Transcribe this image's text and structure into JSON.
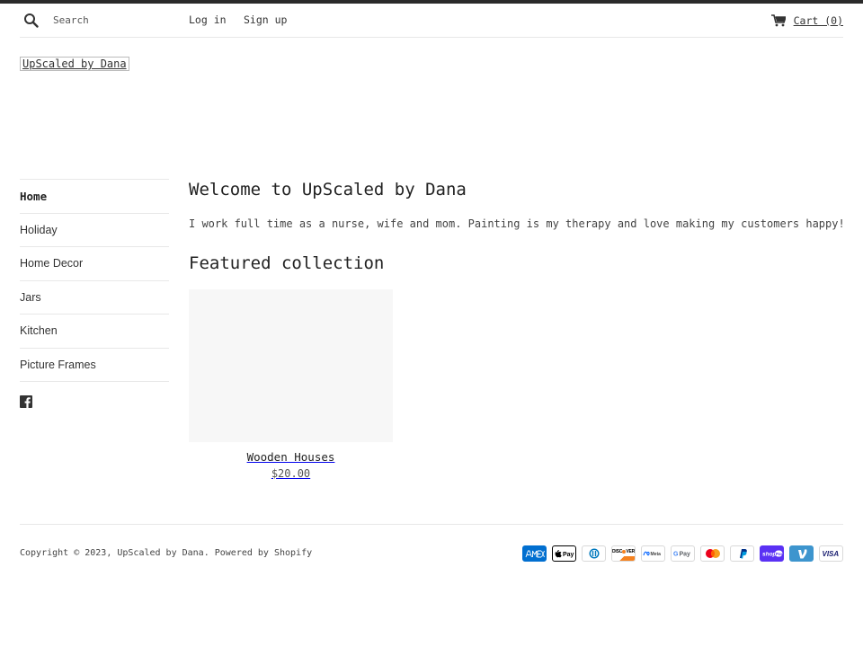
{
  "header": {
    "search_placeholder": "Search",
    "login_label": "Log in",
    "signup_label": "Sign up",
    "cart_label": "Cart (0)"
  },
  "logo_text": "UpScaled by Dana",
  "sidebar": {
    "items": [
      {
        "label": "Home",
        "active": true
      },
      {
        "label": "Holiday"
      },
      {
        "label": "Home Decor"
      },
      {
        "label": "Jars"
      },
      {
        "label": "Kitchen"
      },
      {
        "label": "Picture Frames"
      }
    ],
    "social_icon": "facebook-icon"
  },
  "main": {
    "welcome_title": "Welcome to UpScaled by Dana",
    "intro_text": "I work full time as a nurse, wife and mom. Painting is my therapy and love making my customers happy!",
    "featured_title": "Featured collection",
    "products": [
      {
        "title": "Wooden Houses",
        "price": "$20.00"
      }
    ]
  },
  "footer": {
    "copyright": "Copyright © 2023, UpScaled by Dana. Powered by Shopify",
    "payment_icons": [
      "amex-icon",
      "apple-pay-icon",
      "diners-club-icon",
      "discover-icon",
      "meta-pay-icon",
      "google-pay-icon",
      "mastercard-icon",
      "paypal-icon",
      "shop-pay-icon",
      "venmo-icon",
      "visa-icon"
    ]
  },
  "colors": {
    "topbar": "#2a2a2a",
    "text": "#333333",
    "placeholder_bg": "#f7f7f7",
    "divider": "#e8e8e8"
  }
}
